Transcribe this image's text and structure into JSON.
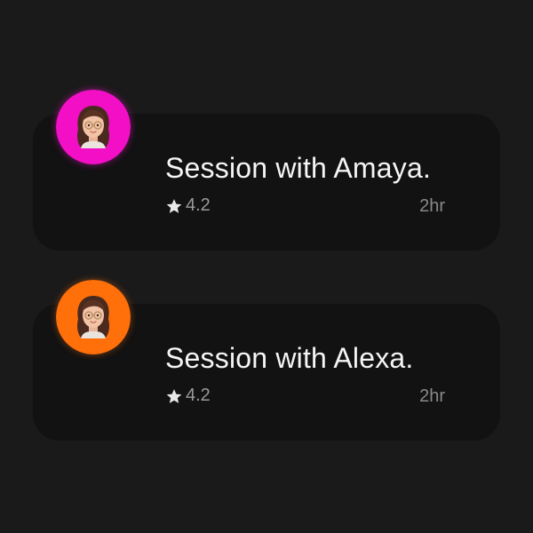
{
  "sessions": [
    {
      "title": "Session with Amaya.",
      "rating": "4.2",
      "duration": "2hr",
      "avatar_color": "#f20fc5",
      "avatar_icon": "memoji-avatar-icon"
    },
    {
      "title": "Session with Alexa.",
      "rating": "4.2",
      "duration": "2hr",
      "avatar_color": "#ff6f0a",
      "avatar_icon": "memoji-avatar-icon"
    }
  ],
  "colors": {
    "background": "#1a1a1a",
    "card": "#121212",
    "title": "#f5f5f5",
    "muted": "#9a9a9a"
  }
}
